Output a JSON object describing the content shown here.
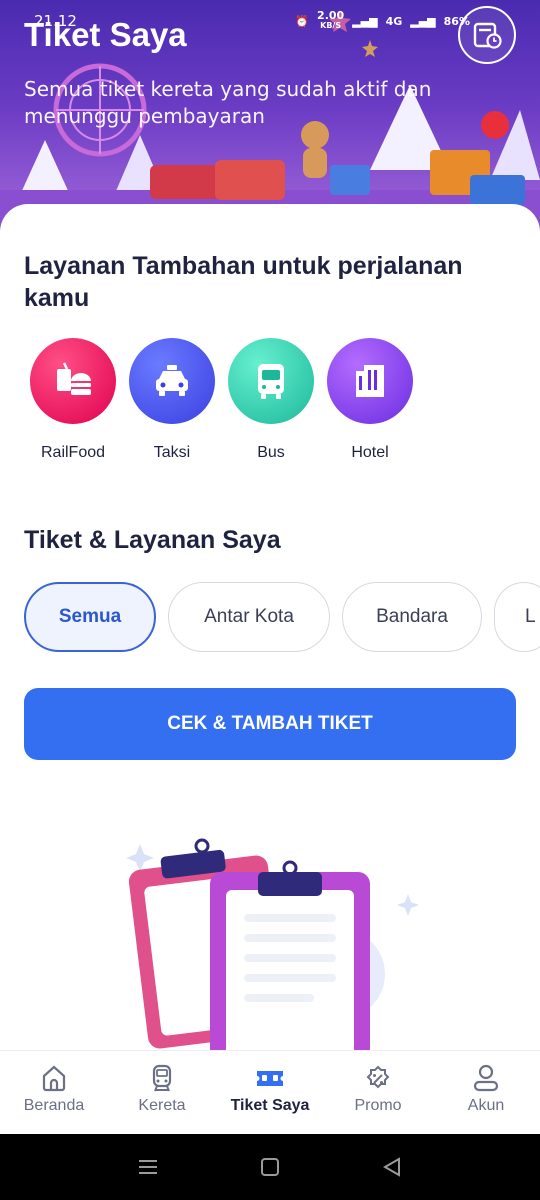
{
  "status_bar": {
    "time": "21.12",
    "speed": "2.00",
    "speed_unit": "KB/S",
    "network": "4G",
    "battery": "86%"
  },
  "header": {
    "title": "Tiket Saya",
    "subtitle": "Semua tiket kereta yang sudah aktif dan menunggu pembayaran",
    "history_icon": "ticket-history-icon"
  },
  "services_section": {
    "title": "Layanan Tambahan untuk perjalanan kamu",
    "items": [
      {
        "label": "RailFood",
        "icon": "food-icon",
        "color_from": "#ff3d77",
        "color_to": "#e0004f"
      },
      {
        "label": "Taksi",
        "icon": "taxi-icon",
        "color_from": "#5a6bff",
        "color_to": "#3a3fe0"
      },
      {
        "label": "Bus",
        "icon": "bus-icon",
        "color_from": "#55e6c6",
        "color_to": "#1cb89a"
      },
      {
        "label": "Hotel",
        "icon": "hotel-icon",
        "color_from": "#a45cff",
        "color_to": "#6a2de0"
      }
    ]
  },
  "tickets_section": {
    "title": "Tiket & Layanan Saya",
    "chips": [
      "Semua",
      "Antar Kota",
      "Bandara",
      "L"
    ],
    "selected_chip": "Semua",
    "cta_label": "CEK & TAMBAH TIKET"
  },
  "bottom_nav": {
    "items": [
      {
        "label": "Beranda",
        "icon": "home-icon"
      },
      {
        "label": "Kereta",
        "icon": "train-icon"
      },
      {
        "label": "Tiket Saya",
        "icon": "ticket-icon"
      },
      {
        "label": "Promo",
        "icon": "promo-icon"
      },
      {
        "label": "Akun",
        "icon": "account-icon"
      }
    ],
    "active": "Tiket Saya"
  },
  "colors": {
    "primary": "#336ff0",
    "text_dark": "#1f2340",
    "nav_inactive": "#6b7086"
  }
}
